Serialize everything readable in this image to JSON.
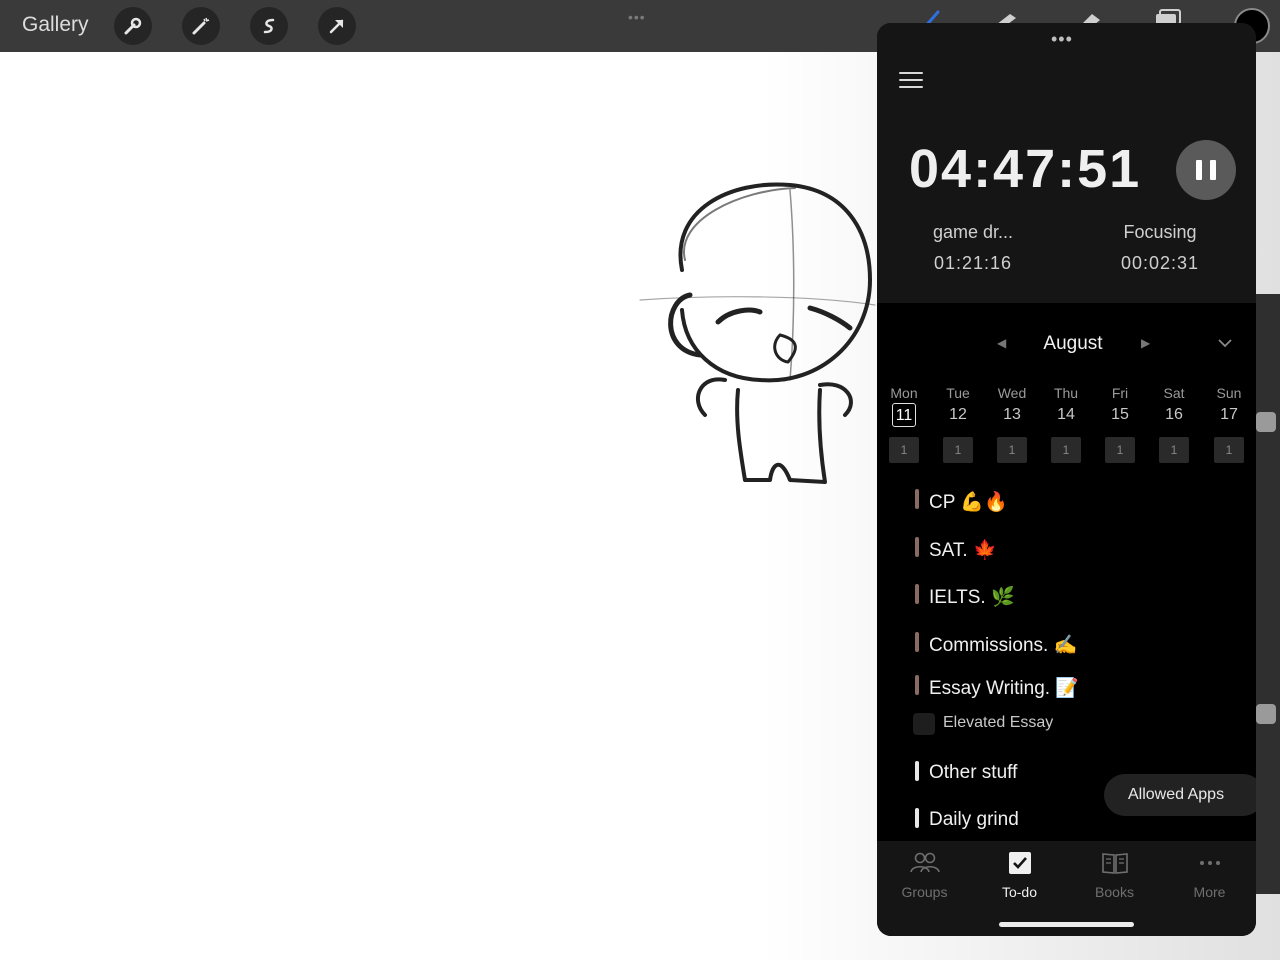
{
  "toolbar": {
    "gallery_label": "Gallery",
    "tools": [
      "wrench-icon",
      "magic-wand-icon",
      "selection-icon",
      "transform-arrow-icon"
    ],
    "right_tools": [
      "brush-icon",
      "smudge-icon",
      "eraser-icon",
      "layers-icon",
      "color-well"
    ]
  },
  "timer": {
    "time": "04:47:51",
    "task_label": "game dr...",
    "task_time": "01:21:16",
    "mode_label": "Focusing",
    "mode_time": "00:02:31"
  },
  "calendar": {
    "month": "August",
    "days": [
      {
        "name": "Mon",
        "num": "11",
        "count": "1",
        "selected": true
      },
      {
        "name": "Tue",
        "num": "12",
        "count": "1"
      },
      {
        "name": "Wed",
        "num": "13",
        "count": "1"
      },
      {
        "name": "Thu",
        "num": "14",
        "count": "1"
      },
      {
        "name": "Fri",
        "num": "15",
        "count": "1"
      },
      {
        "name": "Sat",
        "num": "16",
        "count": "1"
      },
      {
        "name": "Sun",
        "num": "17",
        "count": "1"
      }
    ]
  },
  "tasks": [
    {
      "label": "CP 💪🔥",
      "color": "#8a6b62"
    },
    {
      "label": "SAT. 🍁",
      "color": "#8a6b62"
    },
    {
      "label": "IELTS. 🌿",
      "color": "#8a6b62"
    },
    {
      "label": "Commissions. ✍️",
      "color": "#8a6b62"
    },
    {
      "label": "Essay Writing. 📝",
      "color": "#8a6b62"
    },
    {
      "label": "Other stuff",
      "color": "#e8e8e8"
    },
    {
      "label": "Daily grind",
      "color": "#e8e8e8"
    }
  ],
  "subtask": {
    "label": "Elevated Essay"
  },
  "allowed_apps_label": "Allowed Apps",
  "tabbar": {
    "tabs": [
      {
        "label": "Groups",
        "icon": "groups-icon"
      },
      {
        "label": "To-do",
        "icon": "todo-check-icon",
        "active": true
      },
      {
        "label": "Books",
        "icon": "book-icon"
      },
      {
        "label": "More",
        "icon": "more-icon"
      }
    ]
  }
}
